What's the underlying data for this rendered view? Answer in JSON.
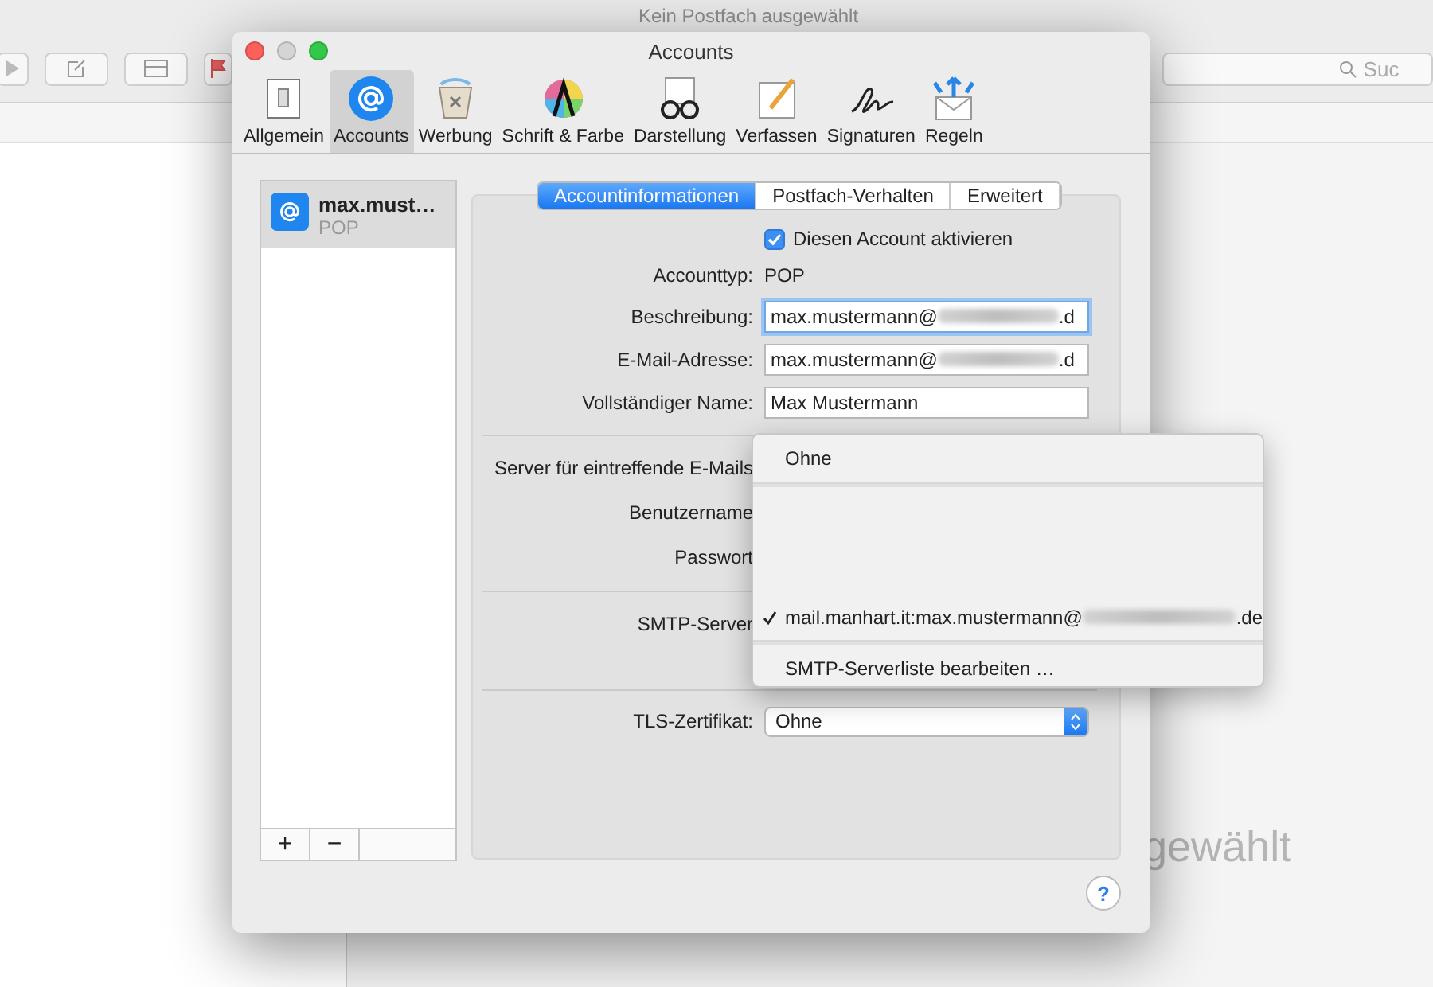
{
  "background": {
    "title": "Kein Postfach ausgewählt",
    "search_placeholder": "Suc",
    "status_text": "gewählt"
  },
  "dialog": {
    "title": "Accounts",
    "toolbar": [
      {
        "kind": "switch",
        "label": "Allgemein",
        "selected": false
      },
      {
        "kind": "at",
        "label": "Accounts",
        "selected": true
      },
      {
        "kind": "trash",
        "label": "Werbung",
        "selected": false
      },
      {
        "kind": "font",
        "label": "Schrift & Farbe",
        "selected": false
      },
      {
        "kind": "glasses",
        "label": "Darstellung",
        "selected": false
      },
      {
        "kind": "pencil",
        "label": "Verfassen",
        "selected": false
      },
      {
        "kind": "signature",
        "label": "Signaturen",
        "selected": false
      },
      {
        "kind": "rules",
        "label": "Regeln",
        "selected": false
      }
    ],
    "accounts": [
      {
        "name": "max.must…",
        "type": "POP",
        "selected": true
      }
    ],
    "list_buttons": [
      "+",
      "−"
    ],
    "tabs": [
      {
        "label": "Accountinformationen",
        "selected": true
      },
      {
        "label": "Postfach-Verhalten",
        "selected": false
      },
      {
        "label": "Erweitert",
        "selected": false
      }
    ],
    "rows": [
      {
        "kind": "checkbox",
        "label": "Diesen Account aktivieren",
        "checked": true
      },
      {
        "kind": "static",
        "label": "Accounttyp:",
        "value": "POP"
      },
      {
        "kind": "input",
        "label": "Beschreibung:",
        "value": "max.mustermann@",
        "value_tail": ".d",
        "focused": true
      },
      {
        "kind": "input",
        "label": "E-Mail-Adresse:",
        "value": "max.mustermann@",
        "value_tail": ".d",
        "focused": false
      },
      {
        "kind": "input",
        "label": "Vollständiger Name:",
        "value": "Max Mustermann",
        "focused": false
      },
      {
        "kind": "separator"
      },
      {
        "kind": "covered",
        "label": "Server für eintreffende E-Mails"
      },
      {
        "kind": "covered",
        "label": "Benutzername"
      },
      {
        "kind": "covered",
        "label": "Passwort"
      },
      {
        "kind": "separator"
      },
      {
        "kind": "covered",
        "label": "SMTP-Server"
      },
      {
        "kind": "blank"
      },
      {
        "kind": "separator"
      },
      {
        "kind": "popup",
        "label": "TLS-Zertifikat:",
        "value": "Ohne"
      }
    ],
    "menu": [
      {
        "kind": "item",
        "label": "Ohne",
        "selected": false
      },
      {
        "kind": "separator"
      },
      {
        "kind": "blank"
      },
      {
        "kind": "item",
        "label": "mail.manhart.it:max.mustermann@",
        "tail": ".de",
        "selected": true
      },
      {
        "kind": "separator"
      },
      {
        "kind": "item",
        "label": "SMTP-Serverliste bearbeiten …",
        "selected": false
      }
    ],
    "help": "?"
  }
}
